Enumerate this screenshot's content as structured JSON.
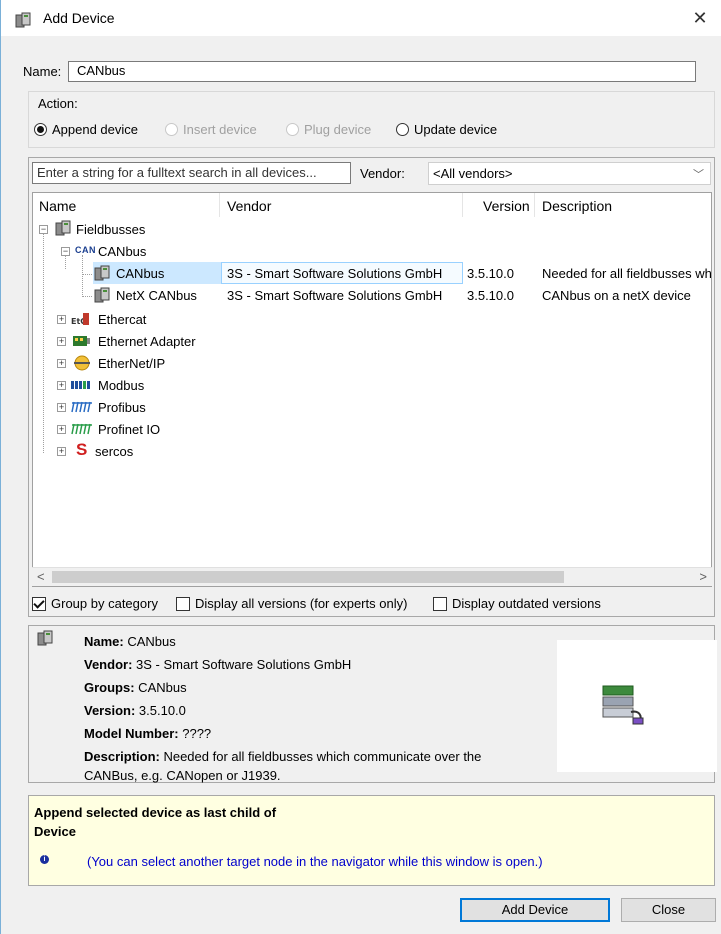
{
  "window": {
    "title": "Add Device",
    "close_glyph": "✕"
  },
  "name_field": {
    "label": "Name:",
    "value": "CANbus"
  },
  "action": {
    "label": "Action:",
    "options": [
      {
        "label": "Append device",
        "checked": true,
        "enabled": true
      },
      {
        "label": "Insert device",
        "checked": false,
        "enabled": false
      },
      {
        "label": "Plug device",
        "checked": false,
        "enabled": false
      },
      {
        "label": "Update device",
        "checked": false,
        "enabled": true
      }
    ]
  },
  "search": {
    "placeholder": "Enter a string for a fulltext search in all devices...",
    "vendor_label": "Vendor:",
    "vendor_value": "<All vendors>"
  },
  "tree": {
    "columns": [
      "Name",
      "Vendor",
      "Version",
      "Description"
    ],
    "rows": [
      {
        "name": "Fieldbusses",
        "vendor": "",
        "version": "",
        "description": "",
        "icon": "device-icon"
      },
      {
        "name": "CANbus",
        "vendor": "",
        "version": "",
        "description": "",
        "icon": "can-icon",
        "icon_text": "CAN"
      },
      {
        "name": "CANbus",
        "vendor": "3S - Smart Software Solutions GmbH",
        "version": "3.5.10.0",
        "description": "Needed for all fieldbusses whi",
        "icon": "device-icon",
        "selected": true
      },
      {
        "name": "NetX CANbus",
        "vendor": "3S - Smart Software Solutions GmbH",
        "version": "3.5.10.0",
        "description": "CANbus on a netX device",
        "icon": "device-icon"
      },
      {
        "name": "Ethercat",
        "icon": "ethercat-icon"
      },
      {
        "name": "Ethernet Adapter",
        "icon": "ethernet-adapter-icon"
      },
      {
        "name": "EtherNet/IP",
        "icon": "ethernet-ip-icon"
      },
      {
        "name": "Modbus",
        "icon": "modbus-icon"
      },
      {
        "name": "Profibus",
        "icon": "profibus-icon"
      },
      {
        "name": "Profinet IO",
        "icon": "profinet-icon"
      },
      {
        "name": "sercos",
        "icon": "sercos-icon",
        "icon_text": "S"
      }
    ]
  },
  "options": {
    "group_by_category": {
      "label": "Group by category",
      "checked": true
    },
    "display_all_versions": {
      "label": "Display all versions (for experts only)",
      "checked": false
    },
    "display_outdated": {
      "label": "Display outdated versions",
      "checked": false
    }
  },
  "info": {
    "name_label": "Name:",
    "name_value": " CANbus",
    "vendor_label": "Vendor:",
    "vendor_value": " 3S - Smart Software Solutions GmbH",
    "groups_label": "Groups:",
    "groups_value": " CANbus",
    "version_label": "Version:",
    "version_value": " 3.5.10.0",
    "model_label": "Model Number:",
    "model_value": " ????",
    "description_label": "Description:",
    "description_value": " Needed for all fieldbusses which communicate over the",
    "description_cont": "CANBus, e.g. CANopen or J1939."
  },
  "append": {
    "title_line1": "Append selected device as last child of",
    "title_line2": "Device",
    "note": "(You can select another target node in the navigator while this window is open.)"
  },
  "buttons": {
    "add": "Add Device",
    "close": "Close"
  }
}
